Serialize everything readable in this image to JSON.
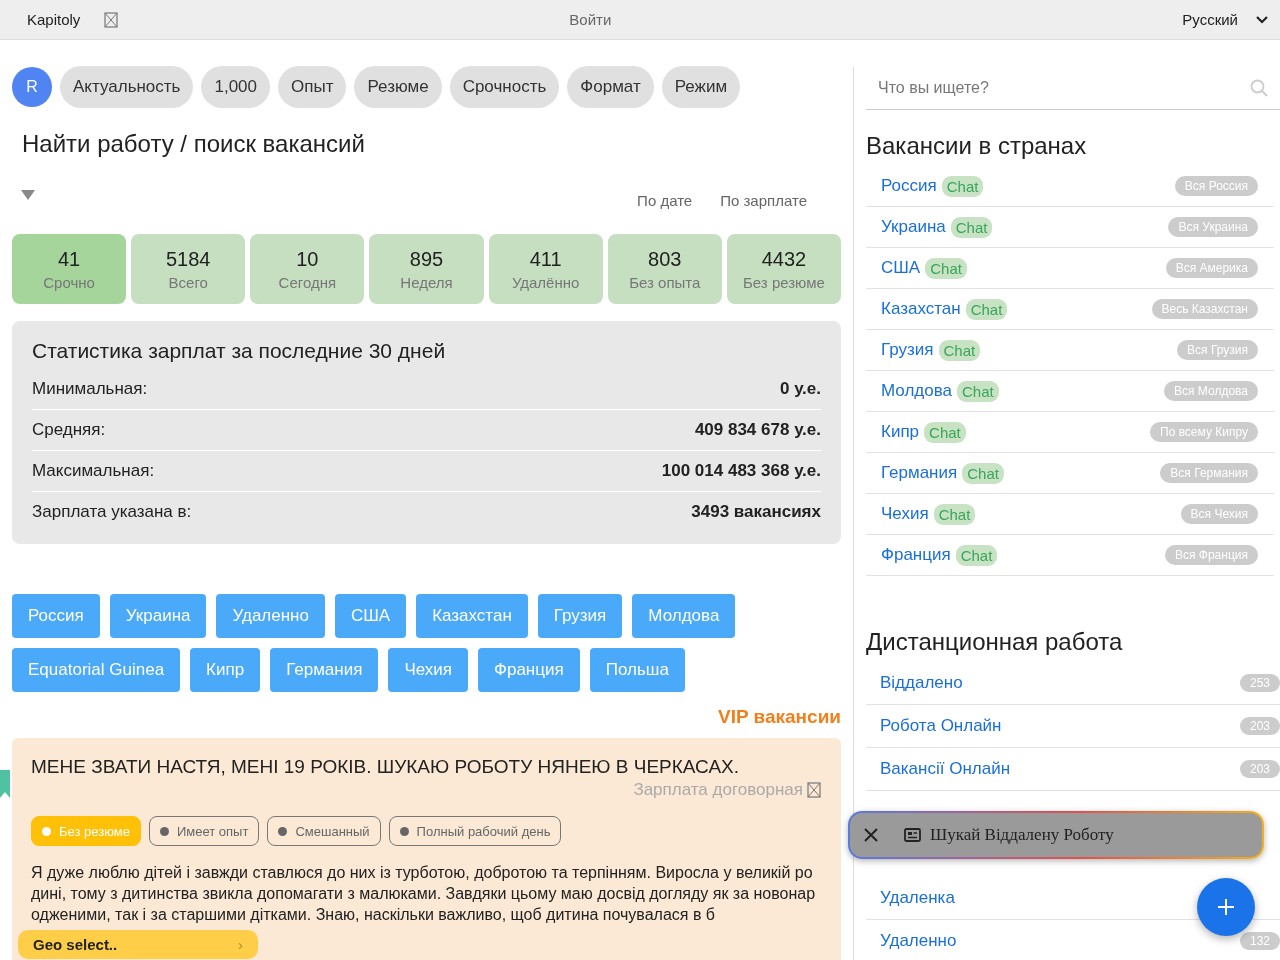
{
  "top_bar": {
    "brand": "Kapitoly",
    "login": "Войти",
    "language": "Русский"
  },
  "filters": {
    "avatar": "R",
    "chips": [
      "Актуальность",
      "1,000",
      "Опыт",
      "Резюме",
      "Срочность",
      "Формат",
      "Режим"
    ]
  },
  "heading": "Найти работу / поиск вакансий",
  "sort_links": [
    "По дате",
    "По зарплате"
  ],
  "stat_tiles": [
    {
      "count": "41",
      "label": "Срочно",
      "selected": true
    },
    {
      "count": "5184",
      "label": "Всего",
      "selected": false
    },
    {
      "count": "10",
      "label": "Сегодня",
      "selected": false
    },
    {
      "count": "895",
      "label": "Неделя",
      "selected": false
    },
    {
      "count": "411",
      "label": "Удалённо",
      "selected": false
    },
    {
      "count": "803",
      "label": "Без опыта",
      "selected": false
    },
    {
      "count": "4432",
      "label": "Без резюме",
      "selected": false
    }
  ],
  "salary_stats": {
    "title": "Статистика зарплат за последние 30 дней",
    "rows": [
      {
        "label": "Минимальная:",
        "value": "0 у.е."
      },
      {
        "label": "Средняя:",
        "value": "409 834 678 у.е."
      },
      {
        "label": "Максимальная:",
        "value": "100 014 483 368 у.е."
      },
      {
        "label": "Зарплата указана в:",
        "value": "3493 вакансиях"
      }
    ]
  },
  "country_buttons": [
    "Россия",
    "Украина",
    "Удаленно",
    "США",
    "Казахстан",
    "Грузия",
    "Молдова",
    "Equatorial Guinea",
    "Кипр",
    "Германия",
    "Чехия",
    "Франция",
    "Польша"
  ],
  "vip": {
    "title": "VIP вакансии",
    "card": {
      "title": "МЕНЕ ЗВАТИ НАСТЯ, МЕНІ 19 РОКІВ. ШУКАЮ РОБОТУ НЯНЕЮ В ЧЕРКАСАХ.",
      "salary": "Зарплата договорная",
      "tags": [
        {
          "label": "Без резюме",
          "selected": true
        },
        {
          "label": "Имеет опыт",
          "selected": false
        },
        {
          "label": "Смешанный",
          "selected": false
        },
        {
          "label": "Полный рабочий день",
          "selected": false
        }
      ],
      "description": "Я дуже люблю дітей і завжди ставлюся до них із турботою, добротою та терпінням. Виросла у великій родині, тому з дитинства звикла допомагати з малюками. Завдяки цьому маю досвід догляду як за новонародженими, так і за старшими дітками. Знаю, наскільки важливо, щоб дитина почувалася в б"
    }
  },
  "search": {
    "placeholder": "Что вы ищете?"
  },
  "countries_section": {
    "title": "Вакансии в странах",
    "items": [
      {
        "name": "Россия",
        "badge": "Chat",
        "scope": "Вся Россия"
      },
      {
        "name": "Украина",
        "badge": "Chat",
        "scope": "Вся Украина"
      },
      {
        "name": "США",
        "badge": "Chat",
        "scope": "Вся Америка"
      },
      {
        "name": "Казахстан",
        "badge": "Chat",
        "scope": "Весь Казахстан"
      },
      {
        "name": "Грузия",
        "badge": "Chat",
        "scope": "Вся Грузия"
      },
      {
        "name": "Молдова",
        "badge": "Chat",
        "scope": "Вся Молдова"
      },
      {
        "name": "Кипр",
        "badge": "Chat",
        "scope": "По всему Кипру"
      },
      {
        "name": "Германия",
        "badge": "Chat",
        "scope": "Вся Германия"
      },
      {
        "name": "Чехия",
        "badge": "Chat",
        "scope": "Вся Чехия"
      },
      {
        "name": "Франция",
        "badge": "Chat",
        "scope": "Вся Франция"
      }
    ]
  },
  "remote_section": {
    "title": "Дистанционная работа",
    "items": [
      {
        "name": "Віддалено",
        "count": "253"
      },
      {
        "name": "Робота Онлайн",
        "count": "203"
      },
      {
        "name": "Вакансії Онлайн",
        "count": "203"
      },
      {
        "name": "Удаленка"
      },
      {
        "name": "Удаленно",
        "count": "132"
      }
    ]
  },
  "promo_bar": {
    "text": "Шукай Віддалену Роботу"
  },
  "geo_select": {
    "label": "Geo select..",
    "arrow": "›"
  }
}
